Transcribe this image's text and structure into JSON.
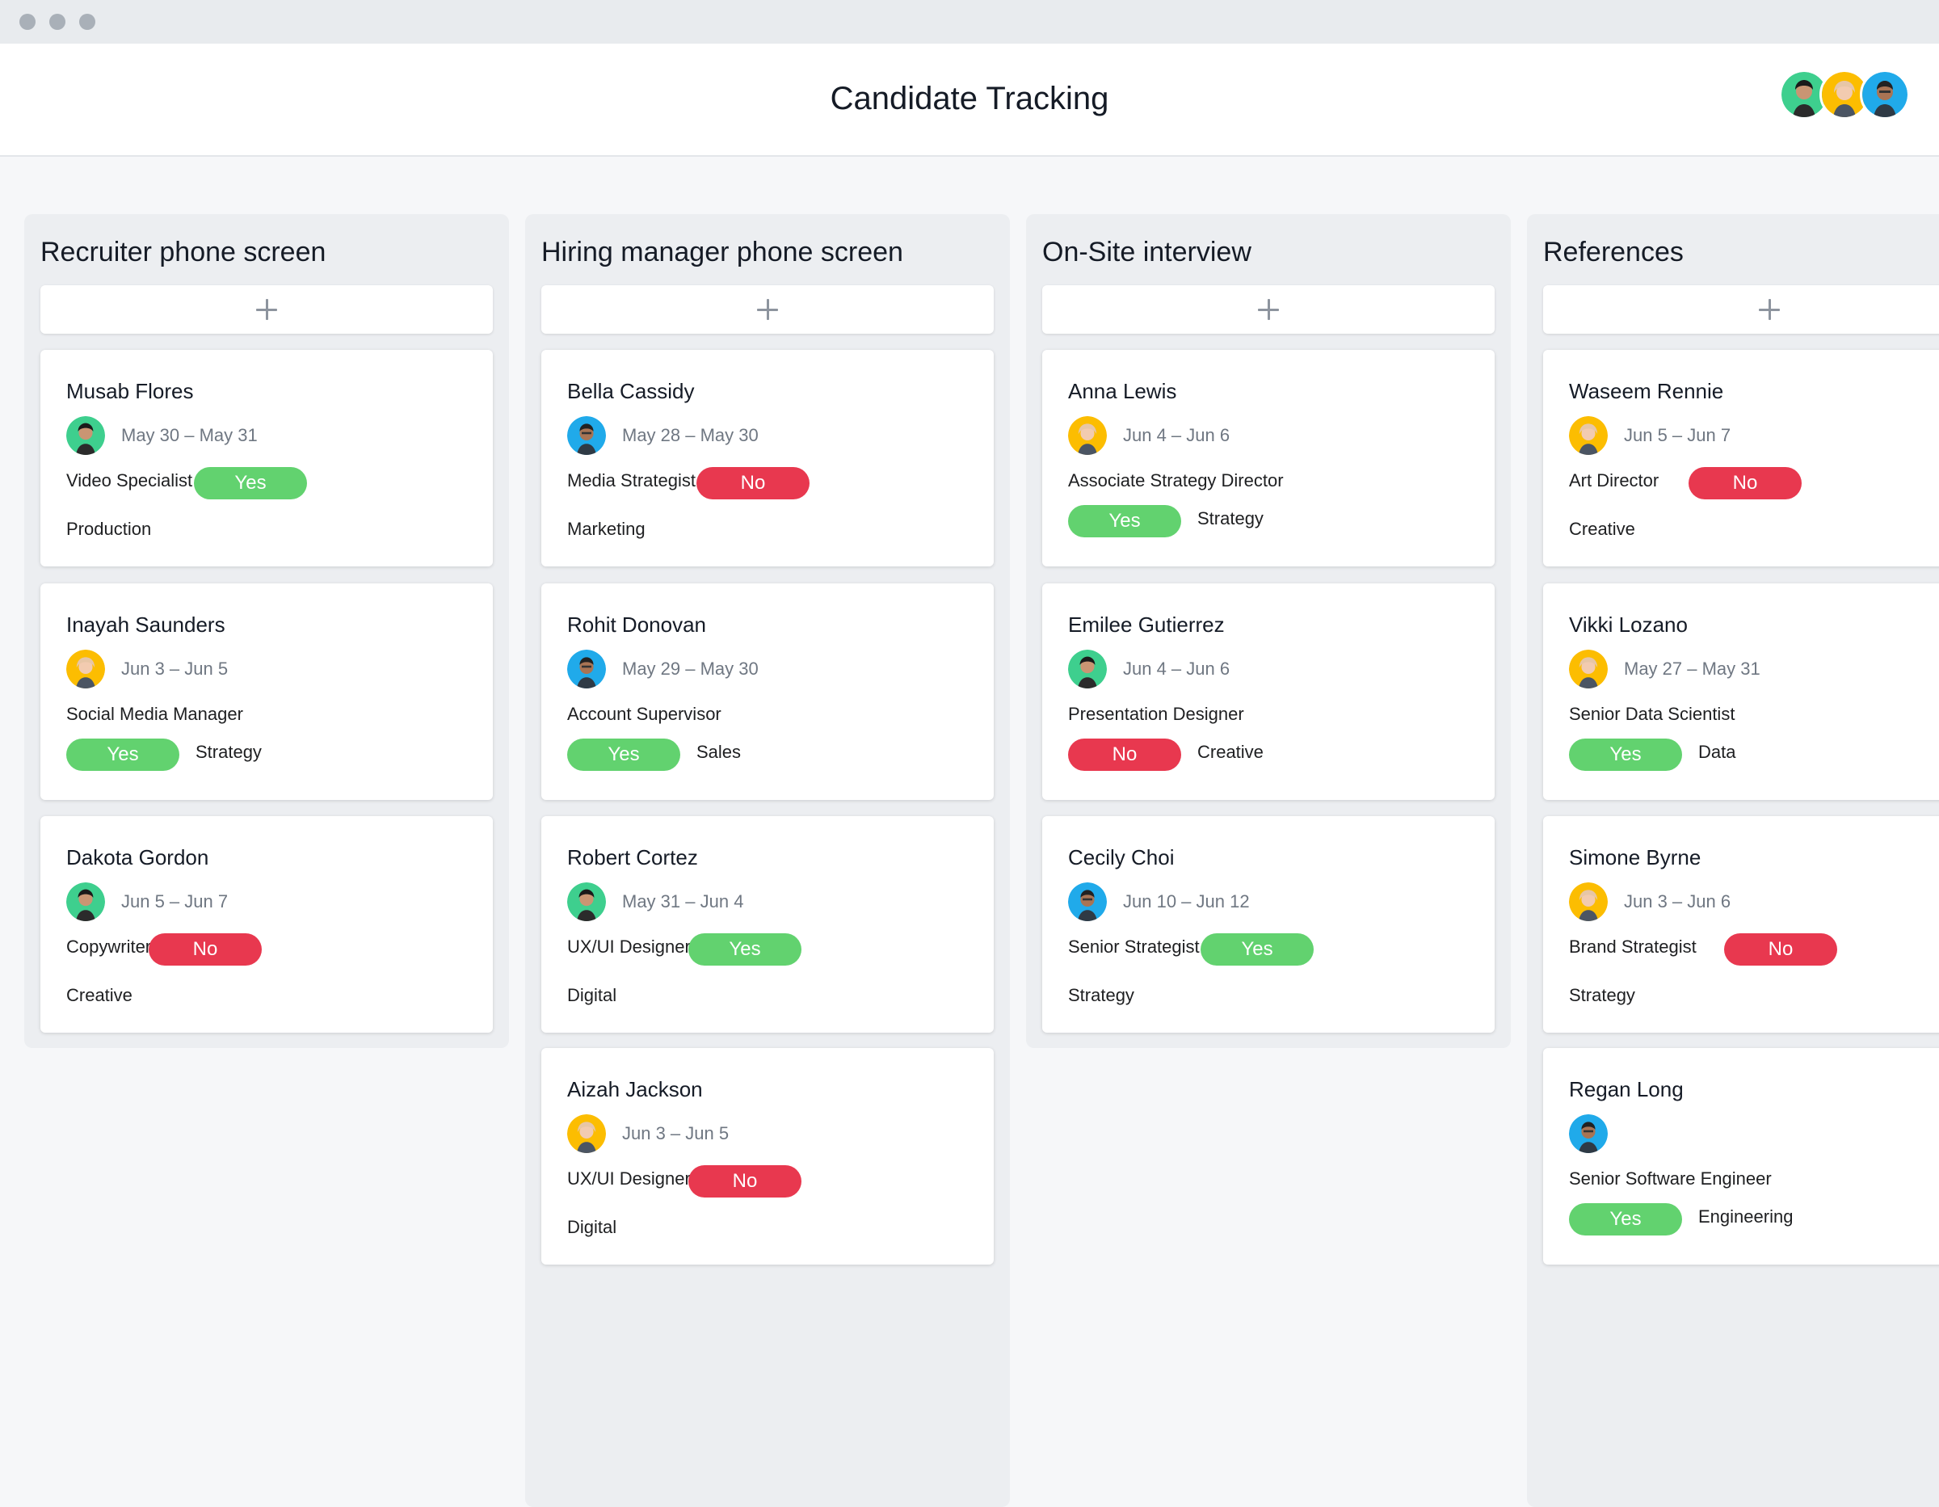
{
  "window": {
    "title": "Candidate Tracking"
  },
  "colors": {
    "yes": "#62d26f",
    "no": "#e8384f",
    "background": "#f6f7f9",
    "column": "#eceef1"
  },
  "icons": {
    "add": "plus-icon",
    "avatar": "avatar"
  },
  "columns": [
    {
      "title": "Recruiter phone screen",
      "cards": [
        {
          "name": "Musab Flores",
          "dates": "May 30 – May 31",
          "role": "Video Specialist",
          "status": "Yes",
          "dept": "Production",
          "avatar": "green"
        },
        {
          "name": "Inayah Saunders",
          "dates": "Jun 3 – Jun 5",
          "role": "Social Media Manager",
          "status": "Yes",
          "dept": "Strategy",
          "avatar": "yellow"
        },
        {
          "name": "Dakota Gordon",
          "dates": "Jun 5 – Jun 7",
          "role": "Copywriter",
          "status": "No",
          "dept": "Creative",
          "avatar": "green"
        }
      ]
    },
    {
      "title": "Hiring manager phone screen",
      "cards": [
        {
          "name": "Bella Cassidy",
          "dates": "May 28 – May 30",
          "role": "Media Strategist",
          "status": "No",
          "dept": "Marketing",
          "avatar": "blue"
        },
        {
          "name": "Rohit Donovan",
          "dates": "May 29 – May 30",
          "role": "Account Supervisor",
          "status": "Yes",
          "dept": "Sales",
          "avatar": "blue"
        },
        {
          "name": "Robert Cortez",
          "dates": "May 31 – Jun 4",
          "role": "UX/UI Designer",
          "status": "Yes",
          "dept": "Digital",
          "avatar": "green"
        },
        {
          "name": "Aizah Jackson",
          "dates": "Jun 3 – Jun 5",
          "role": "UX/UI Designer",
          "status": "No",
          "dept": "Digital",
          "avatar": "yellow"
        }
      ]
    },
    {
      "title": "On-Site interview",
      "cards": [
        {
          "name": "Anna Lewis",
          "dates": "Jun 4 – Jun 6",
          "role": "Associate Strategy Director",
          "status": "Yes",
          "dept": "Strategy",
          "avatar": "yellow"
        },
        {
          "name": "Emilee Gutierrez",
          "dates": "Jun 4 – Jun 6",
          "role": "Presentation Designer",
          "status": "No",
          "dept": "Creative",
          "avatar": "green"
        },
        {
          "name": "Cecily Choi",
          "dates": "Jun 10 – Jun 12",
          "role": "Senior Strategist",
          "status": "Yes",
          "dept": "Strategy",
          "avatar": "blue"
        }
      ]
    },
    {
      "title": "References",
      "cards": [
        {
          "name": "Waseem Rennie",
          "dates": "Jun 5 – Jun 7",
          "role": "Art Director",
          "status": "No",
          "dept": "Creative",
          "avatar": "yellow"
        },
        {
          "name": "Vikki Lozano",
          "dates": "May 27 – May 31",
          "role": "Senior Data Scientist",
          "status": "Yes",
          "dept": "Data",
          "avatar": "yellow"
        },
        {
          "name": "Simone Byrne",
          "dates": "Jun 3 – Jun 6",
          "role": "Brand Strategist",
          "status": "No",
          "dept": "Strategy",
          "avatar": "yellow"
        },
        {
          "name": "Regan Long",
          "dates": "",
          "role": "Senior Software Engineer",
          "status": "Yes",
          "dept": "Engineering",
          "avatar": "blue"
        }
      ]
    }
  ]
}
